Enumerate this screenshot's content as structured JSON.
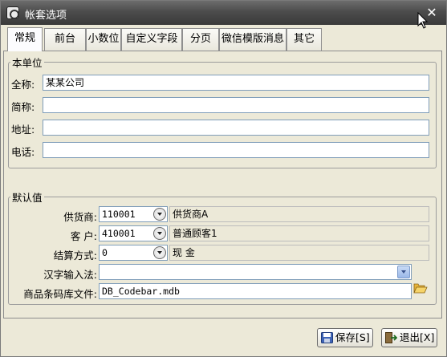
{
  "window": {
    "title": "帐套选项"
  },
  "tabs": [
    {
      "label": "常规",
      "active": true
    },
    {
      "label": "前台"
    },
    {
      "label": "小数位"
    },
    {
      "label": "自定义字段"
    },
    {
      "label": "分页"
    },
    {
      "label": "微信模版消息"
    },
    {
      "label": "其它"
    }
  ],
  "unit": {
    "legend": "本单位",
    "fullname_label": "全称:",
    "fullname_value": "某某公司",
    "shortname_label": "简称:",
    "shortname_value": "",
    "address_label": "地址:",
    "address_value": "",
    "phone_label": "电话:",
    "phone_value": ""
  },
  "defaults": {
    "legend": "默认值",
    "supplier_label": "供货商:",
    "supplier_code": "110001",
    "supplier_name": "供货商A",
    "customer_label": "客  户:",
    "customer_code": "410001",
    "customer_name": "普通顾客1",
    "settlement_label": "结算方式:",
    "settlement_code": "0",
    "settlement_name": "现  金",
    "ime_label": "汉字输入法:",
    "ime_value": "",
    "barcode_label": "商品条码库文件:",
    "barcode_value": "DB_Codebar.mdb"
  },
  "buttons": {
    "save": "保存[S]",
    "exit": "退出[X]"
  },
  "icons": [
    "window-app-icon",
    "close-icon",
    "mouse-cursor-icon",
    "dropdown-arrow-icon",
    "folder-open-icon",
    "save-disk-icon",
    "exit-door-icon"
  ]
}
